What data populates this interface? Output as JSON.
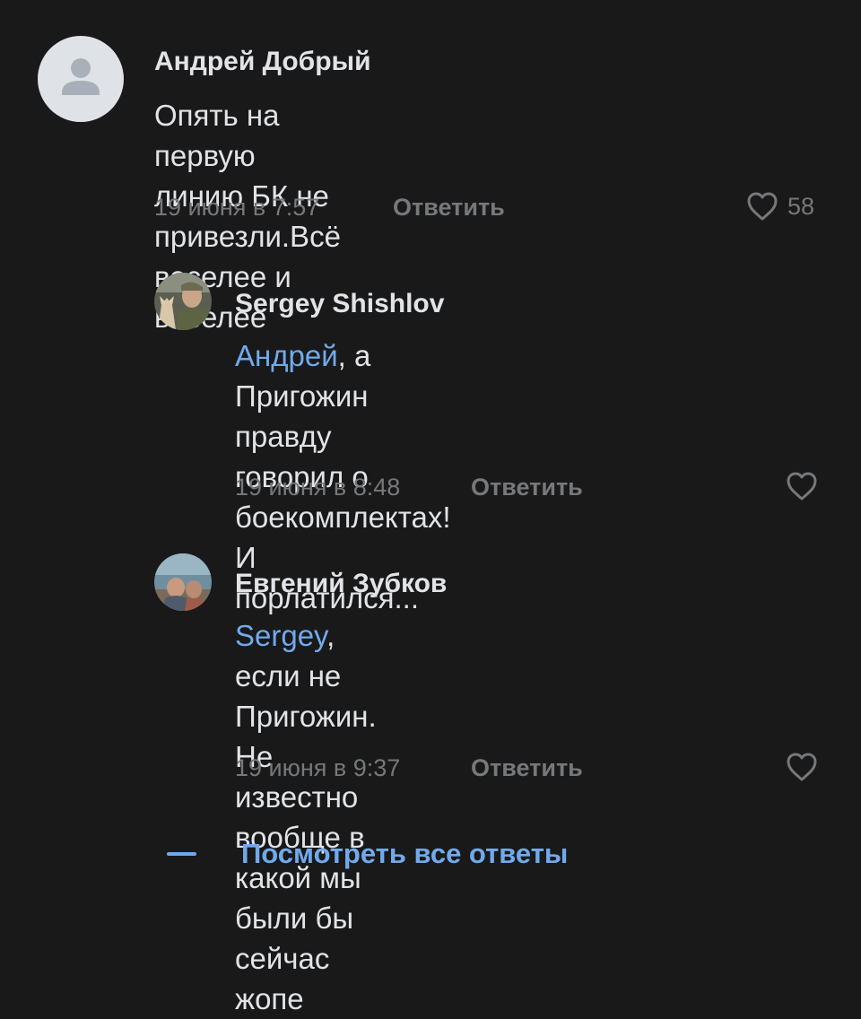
{
  "comments": [
    {
      "author": "Андрей Добрый",
      "avatar": "default-user-avatar",
      "text_lines": [
        "Опять на первую линию БК не",
        "привезли.Всё веселее и веселее"
      ],
      "date": "19 июня в 7:57",
      "reply_label": "Ответить",
      "likes": "58"
    },
    {
      "author": "Sergey Shishlov",
      "avatar": "photo-avatar",
      "mention": "Андрей",
      "text_first": ", а Пригожин правду",
      "text_lines": [
        "говорил о боекомплектах! И",
        "порлатился..."
      ],
      "date": "19 июня в 8:48",
      "reply_label": "Ответить"
    },
    {
      "author": "Евгений Зубков",
      "avatar": "photo-avatar",
      "mention": "Sergey",
      "text_first": ", если не Пригожин. Не",
      "text_lines": [
        "известно вообще в какой мы",
        "были бы сейчас жопе"
      ],
      "date": "19 июня в 9:37",
      "reply_label": "Ответить"
    }
  ],
  "view_all_label": "Посмотреть все ответы",
  "colors": {
    "background": "#19191a",
    "text": "#e1e3e6",
    "secondary": "#76787a",
    "link": "#71aaeb"
  }
}
